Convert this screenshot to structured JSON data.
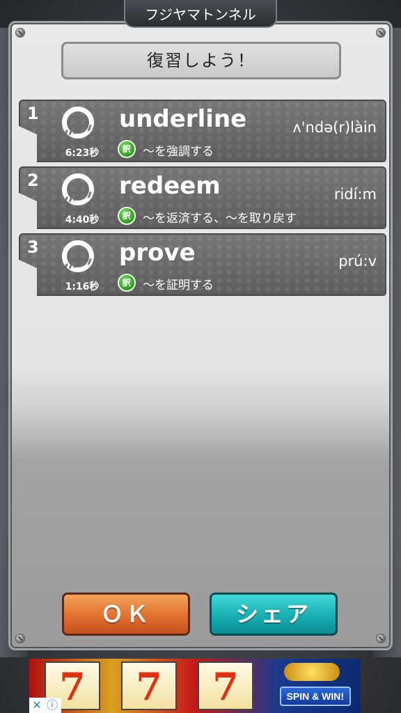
{
  "header": {
    "stage_name": "フジヤマトンネル"
  },
  "dialog": {
    "title": "復習しよう！",
    "translation_badge": "訳",
    "items": [
      {
        "number": "1",
        "word": "underline",
        "pronunciation": "ʌ'ndə(r)làin",
        "time": "6:23秒",
        "meaning": "〜を強調する"
      },
      {
        "number": "2",
        "word": "redeem",
        "pronunciation": "ridí:m",
        "time": "4:40秒",
        "meaning": "〜を返済する、〜を取り戻す"
      },
      {
        "number": "3",
        "word": "prove",
        "pronunciation": "prú:v",
        "time": "1:16秒",
        "meaning": "〜を証明する"
      }
    ],
    "ok_label": "ＯＫ",
    "share_label": "シェア"
  },
  "ad": {
    "cta": "SPIN & WIN!",
    "reel_symbol": "7",
    "close_icon": "close-icon",
    "info_icon": "info-icon"
  },
  "colors": {
    "ok_button": "#e0702e",
    "share_button": "#18aeb2",
    "badge_green": "#2c9a1e"
  }
}
